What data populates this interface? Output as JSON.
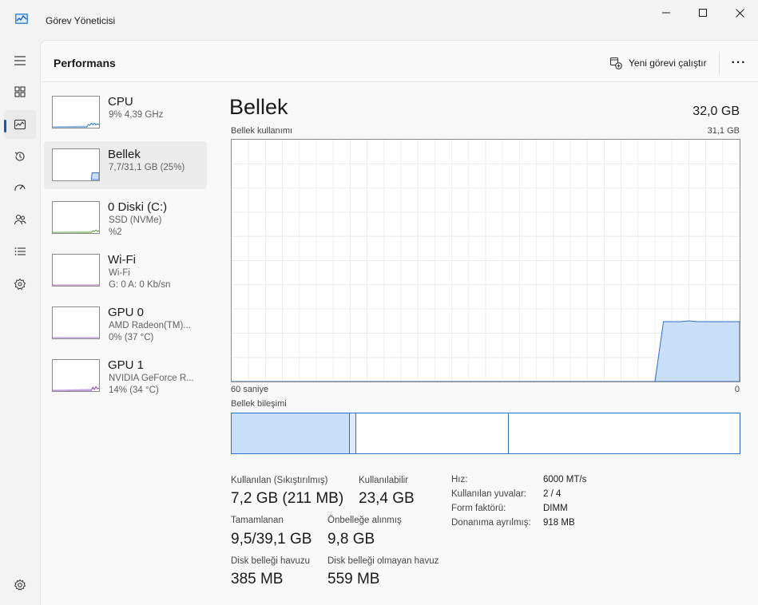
{
  "window": {
    "title": "Görev Yöneticisi"
  },
  "header": {
    "title": "Performans",
    "run_task_label": "Yeni görevi çalıştır",
    "more_label": "···"
  },
  "resources": [
    {
      "name": "CPU",
      "sub1": "9% 4,39 GHz",
      "sub2": ""
    },
    {
      "name": "Bellek",
      "sub1": "7,7/31,1 GB (25%)",
      "sub2": ""
    },
    {
      "name": "0 Diski (C:)",
      "sub1": "SSD (NVMe)",
      "sub2": "%2"
    },
    {
      "name": "Wi-Fi",
      "sub1": "Wi-Fi",
      "sub2": "G: 0 A: 0 Kb/sn"
    },
    {
      "name": "GPU 0",
      "sub1": "AMD Radeon(TM)...",
      "sub2": "0% (37 °C)"
    },
    {
      "name": "GPU 1",
      "sub1": "NVIDIA GeForce R...",
      "sub2": "14% (34 °C)"
    }
  ],
  "detail": {
    "title": "Bellek",
    "total": "32,0 GB",
    "usage_label": "Bellek kullanımı",
    "usage_max": "31,1 GB",
    "axis_left": "60 saniye",
    "axis_right": "0",
    "composition_label": "Bellek bileşimi",
    "graph": {
      "max_gb": 31.1,
      "history_seconds": 60,
      "samples_gb": [
        0,
        0,
        0,
        0,
        0,
        0,
        0,
        0,
        0,
        0,
        0,
        0,
        0,
        0,
        0,
        0,
        0,
        0,
        0,
        0,
        0,
        0,
        0,
        0,
        0,
        0,
        0,
        0,
        0,
        0,
        0,
        0,
        0,
        0,
        0,
        0,
        0,
        0,
        0,
        0,
        0,
        0,
        0,
        0,
        0,
        0,
        0,
        0,
        0,
        0,
        0,
        7.7,
        7.7,
        7.7,
        7.8,
        7.7,
        7.7,
        7.7,
        7.7,
        7.7,
        7.7
      ]
    },
    "composition": [
      {
        "name": "in-use",
        "fraction": 0.232
      },
      {
        "name": "modified",
        "fraction": 0.014
      },
      {
        "name": "standby",
        "fraction": 0.3
      },
      {
        "name": "free",
        "fraction": 0.454
      }
    ],
    "stats": {
      "in_use_label": "Kullanılan (Sıkıştırılmış)",
      "in_use_value": "7,2 GB (211 MB)",
      "available_label": "Kullanılabilir",
      "available_value": "23,4 GB",
      "committed_label": "Tamamlanan",
      "committed_value": "9,5/39,1 GB",
      "cached_label": "Önbelleğe alınmış",
      "cached_value": "9,8 GB",
      "paged_label": "Disk belleği havuzu",
      "paged_value": "385 MB",
      "nonpaged_label": "Disk belleği olmayan havuz",
      "nonpaged_value": "559 MB"
    },
    "properties": [
      {
        "key": "Hız:",
        "value": "6000 MT/s"
      },
      {
        "key": "Kullanılan yuvalar:",
        "value": "2 / 4"
      },
      {
        "key": "Form faktörü:",
        "value": "DIMM"
      },
      {
        "key": "Donanıma ayrılmış:",
        "value": "918 MB"
      }
    ]
  },
  "colors": {
    "memory_fill": "#c9def8",
    "memory_line": "#2f6fc6",
    "accent": "#005fb8",
    "cpu_line": "#1b76c9",
    "disk_line": "#4c9a2a",
    "gpu_line": "#8a3fbf"
  },
  "icons": {
    "app": "task-manager-icon",
    "hamburger": "hamburger-menu-icon",
    "processes": "processes-icon",
    "performance": "performance-icon",
    "history": "app-history-icon",
    "startup": "startup-apps-icon",
    "users": "users-icon",
    "details": "details-icon",
    "services": "services-icon",
    "settings": "settings-icon"
  }
}
